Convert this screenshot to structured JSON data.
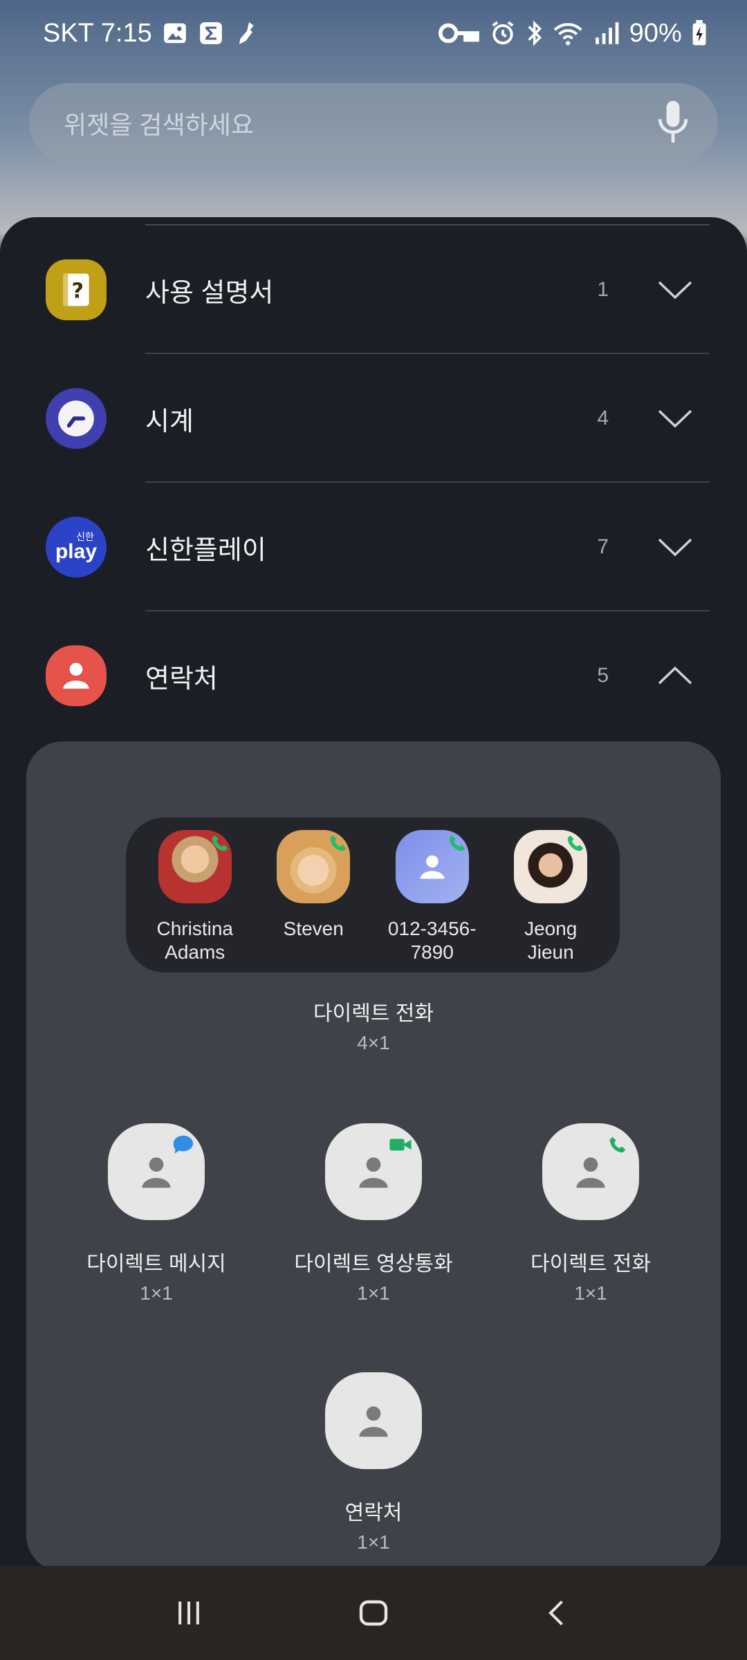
{
  "status_bar": {
    "carrier_time": "SKT 7:15",
    "battery": "90%"
  },
  "search": {
    "placeholder": "위젯을 검색하세요"
  },
  "apps": [
    {
      "name": "사용 설명서",
      "count": "1",
      "expanded": false,
      "icon": "manual-icon",
      "color": "#bfa017"
    },
    {
      "name": "시계",
      "count": "4",
      "expanded": false,
      "icon": "clock-icon",
      "color": "#3f3fb0"
    },
    {
      "name": "신한플레이",
      "count": "7",
      "expanded": false,
      "icon": "shinhan-play-icon",
      "color": "#2b44c7",
      "logo_text_top": "신한",
      "logo_text_main": "play"
    },
    {
      "name": "연락처",
      "count": "5",
      "expanded": true,
      "icon": "contacts-icon",
      "color": "#e5534b"
    }
  ],
  "direct_call_contacts": [
    {
      "name": "Christina\nAdams",
      "line1": "Christina",
      "line2": "Adams"
    },
    {
      "name": "Steven",
      "line1": "Steven",
      "line2": ""
    },
    {
      "name": "012-3456-7890",
      "line1": "012-3456-",
      "line2": "7890"
    },
    {
      "name": "Jeong Jieun",
      "line1": "Jeong",
      "line2": "Jieun"
    }
  ],
  "widgets": {
    "direct_call_4x1": {
      "title": "다이렉트 전화",
      "size": "4×1"
    },
    "direct_message": {
      "title": "다이렉트 메시지",
      "size": "1×1"
    },
    "direct_video": {
      "title": "다이렉트 영상통화",
      "size": "1×1"
    },
    "direct_call": {
      "title": "다이렉트 전화",
      "size": "1×1"
    },
    "contacts": {
      "title": "연락처",
      "size": "1×1"
    }
  }
}
